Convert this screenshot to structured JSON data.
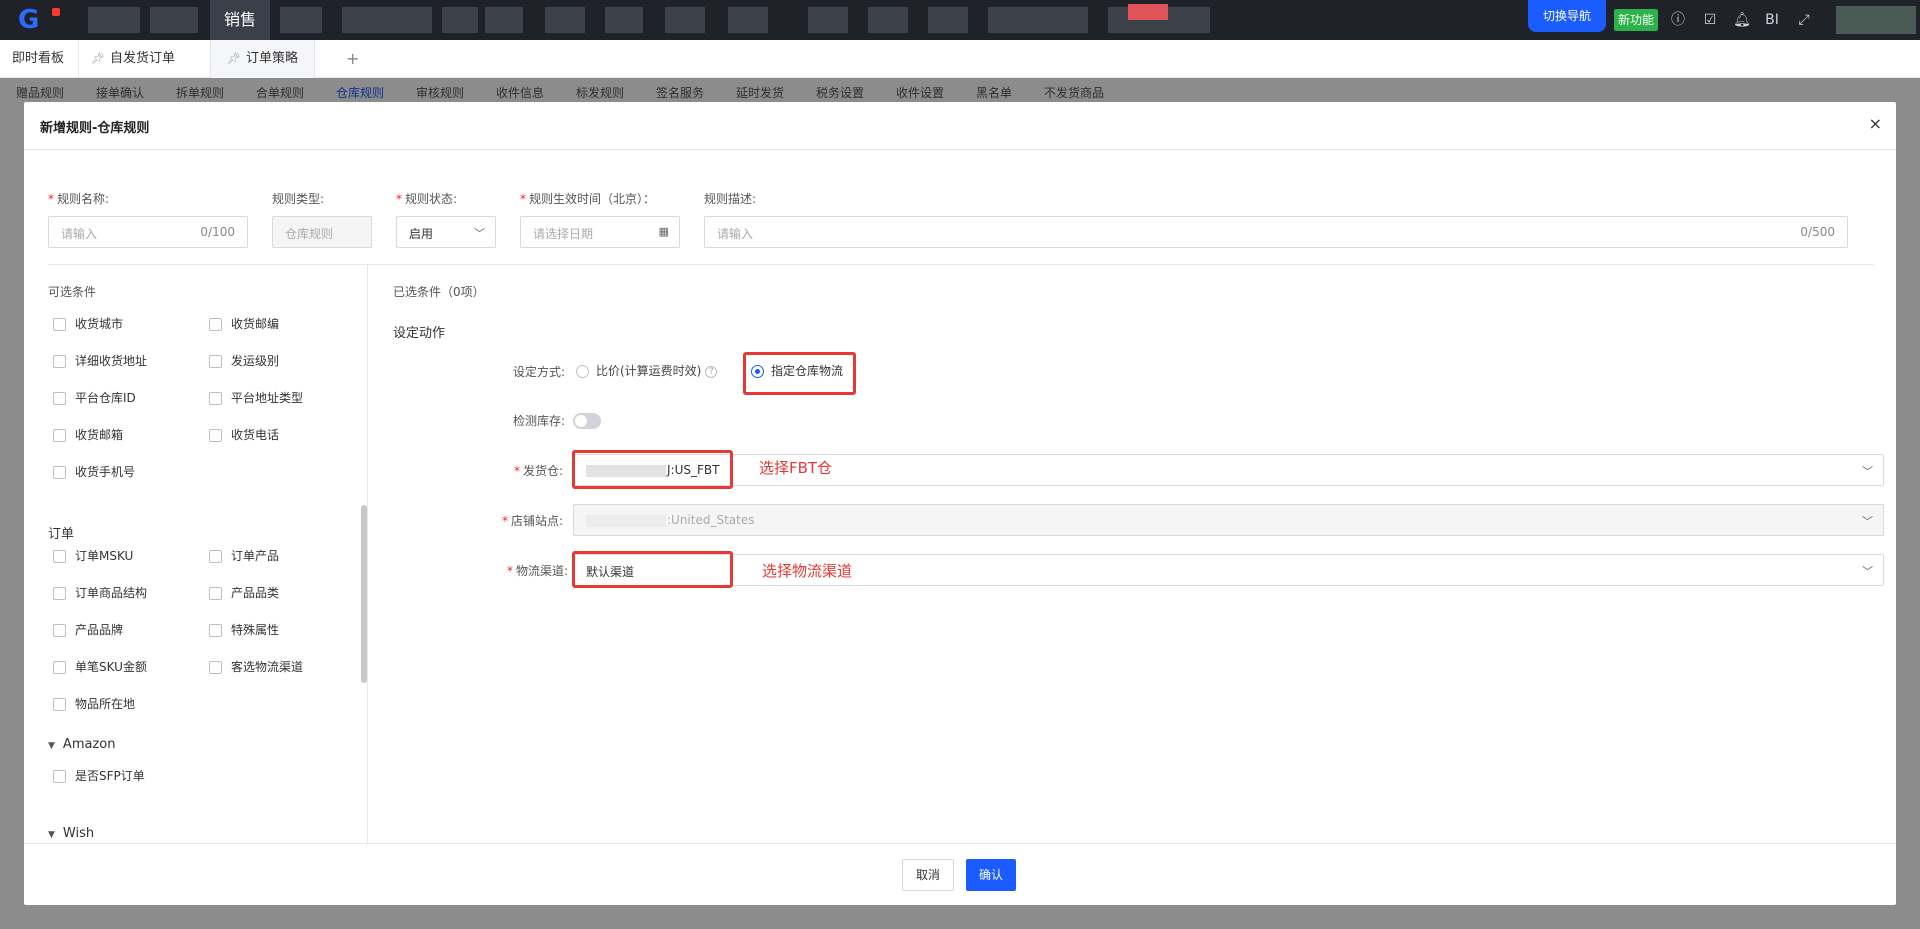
{
  "topbar": {
    "logo": "G",
    "active_nav": "销售",
    "switch_nav": "切换导航",
    "new_feature": "新功能",
    "bi": "BI"
  },
  "tabs": [
    {
      "label": "即时看板"
    },
    {
      "label": "自发货订单"
    },
    {
      "label": "订单策略"
    }
  ],
  "tab_add": "+",
  "subnav": [
    "赠品规则",
    "接单确认",
    "拆单规则",
    "合单规则",
    "仓库规则",
    "审核规则",
    "收件信息",
    "标发规则",
    "签名服务",
    "延时发货",
    "税务设置",
    "收件设置",
    "黑名单",
    "不发货商品"
  ],
  "modal": {
    "title": "新增规则-仓库规则",
    "close": "×",
    "form": {
      "rule_name_label": "规则名称:",
      "rule_name_placeholder": "请输入",
      "rule_name_count": "0/100",
      "rule_type_label": "规则类型:",
      "rule_type_value": "仓库规则",
      "rule_status_label": "规则状态:",
      "rule_status_value": "启用",
      "effective_time_label": "规则生效时间（北京）：",
      "effective_time_placeholder": "请选择日期",
      "description_label": "规则描述:",
      "description_placeholder": "请输入",
      "description_count": "0/500"
    },
    "left": {
      "section_title": "可选条件",
      "address_items": [
        "收货城市",
        "收货邮编",
        "详细收货地址",
        "发运级别",
        "平台仓库ID",
        "平台地址类型",
        "收货邮箱",
        "收货电话",
        "收货手机号"
      ],
      "order_title": "订单",
      "order_items": [
        "订单MSKU",
        "订单产品",
        "订单商品结构",
        "产品品类",
        "产品品牌",
        "特殊属性",
        "单笔SKU金额",
        "客选物流渠道",
        "物品所在地"
      ],
      "amazon_title": "Amazon",
      "amazon_items": [
        "是否SFP订单"
      ],
      "wish_title": "Wish"
    },
    "right": {
      "selected_title": "已选条件（0项）",
      "action_title": "设定动作",
      "method_label": "设定方式:",
      "option_compare": "比价(计算运费时效)",
      "option_assign": "指定仓库物流",
      "check_stock_label": "检测库存:",
      "warehouse_label": "发货仓:",
      "warehouse_value": "J:US_FBT",
      "warehouse_annotation": "选择FBT仓",
      "store_label": "店铺站点:",
      "store_value": ":United_States",
      "channel_label": "物流渠道:",
      "channel_value": "默认渠道",
      "channel_annotation": "选择物流渠道"
    },
    "footer": {
      "cancel": "取消",
      "confirm": "确认"
    }
  }
}
